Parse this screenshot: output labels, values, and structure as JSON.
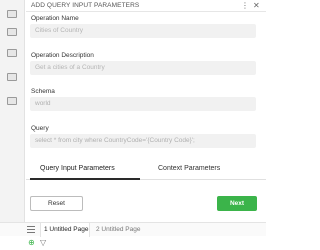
{
  "panel": {
    "title": "ADD QUERY INPUT PARAMETERS",
    "icons": {
      "more": "more-vertical-icon",
      "close": "close-icon"
    }
  },
  "fields": {
    "operation_name": {
      "label": "Operation Name",
      "placeholder": "Cities of Country"
    },
    "operation_description": {
      "label": "Operation Description",
      "placeholder": "Get a cities of a Country"
    },
    "schema": {
      "label": "Schema",
      "value": "world"
    },
    "query": {
      "label": "Query",
      "value": "select * from city where CountryCode='{Country Code}';"
    }
  },
  "tabs": [
    {
      "label": "Query Input Parameters",
      "active": true
    },
    {
      "label": "Context Parameters",
      "active": false
    }
  ],
  "buttons": {
    "reset": "Reset",
    "next": "Next"
  },
  "pages": [
    {
      "label": "1  Untitled Page",
      "active": true
    },
    {
      "label": "2  Untitled Page",
      "active": false
    }
  ],
  "colors": {
    "accent": "#3bb44a",
    "input_bg": "#f1f1f1",
    "rail_bg": "#f3f3f3"
  }
}
